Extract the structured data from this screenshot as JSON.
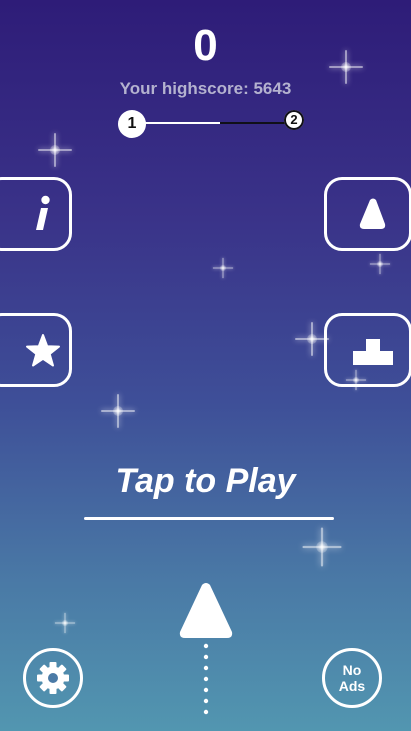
{
  "game": {
    "score": "0",
    "highscore_label": "Your highscore: 5643",
    "level": {
      "current": "1",
      "next": "2",
      "progress": 0.55
    },
    "tap_to_play": "Tap to Play",
    "no_ads_label": "No\nAds"
  },
  "menu": {
    "info_button": {
      "icon": "info-icon"
    },
    "star_button": {
      "icon": "star-icon"
    },
    "shapes_button": {
      "icon": "triangle-icon"
    },
    "leaderboard_button": {
      "icon": "podium-icon"
    },
    "settings_button": {
      "icon": "gear-icon"
    }
  },
  "colors": {
    "background_top": "#2e1c78",
    "background_bottom": "#5296b0",
    "foreground": "#ffffff",
    "highscore_text": "#b4b2cf"
  }
}
